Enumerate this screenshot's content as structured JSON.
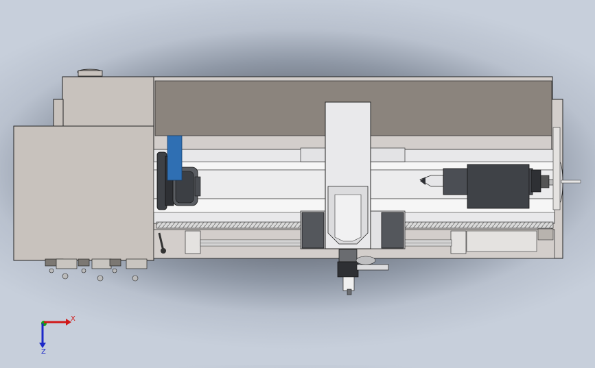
{
  "viewport": {
    "model": "lathe-top-view",
    "colors": {
      "body": "#c8c2bd",
      "body_dark": "#8b847d",
      "bed": "#e4e4e6",
      "metal_dark": "#4b4e54",
      "accent_blue": "#2f6fb3",
      "triad_x": "#d01818",
      "triad_y": "#19a119",
      "triad_z": "#1c28c8"
    }
  },
  "triad": {
    "x_label": "X",
    "z_label": "Z"
  }
}
